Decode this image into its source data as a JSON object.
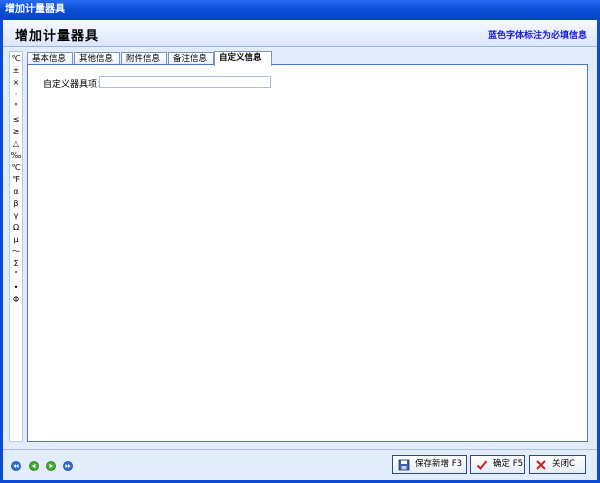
{
  "window": {
    "title": "增加计量器具"
  },
  "header": {
    "title": "增加计量器具",
    "note": "蓝色字体标注为必填信息"
  },
  "symbols": [
    "℃",
    "±",
    "×",
    "·",
    "°",
    "≤",
    "≥",
    "△",
    "‰",
    "℃",
    "℉",
    "α",
    "β",
    "γ",
    "Ω",
    "μ",
    "～",
    "Σ",
    "˚",
    "•",
    "Φ"
  ],
  "tabs": [
    {
      "label": "基本信息"
    },
    {
      "label": "其他信息"
    },
    {
      "label": "附件信息"
    },
    {
      "label": "备注信息"
    },
    {
      "label": "自定义信息",
      "active": true
    }
  ],
  "form": {
    "custom_field_label": "自定义器具项：",
    "custom_field_value": ""
  },
  "footer": {
    "nav": [
      "first-icon",
      "prev-icon",
      "next-icon",
      "last-icon"
    ],
    "buttons": {
      "save_new": "保存新增 F3",
      "confirm": "确定 F5",
      "close": "关闭C"
    }
  },
  "colors": {
    "title_bar": "#0a4fd8",
    "required_note": "#1a1ad8",
    "nav_green": "#3fae2a",
    "nav_blue": "#2c6fd6",
    "confirm_check": "#d02020",
    "close_x": "#d02020"
  }
}
